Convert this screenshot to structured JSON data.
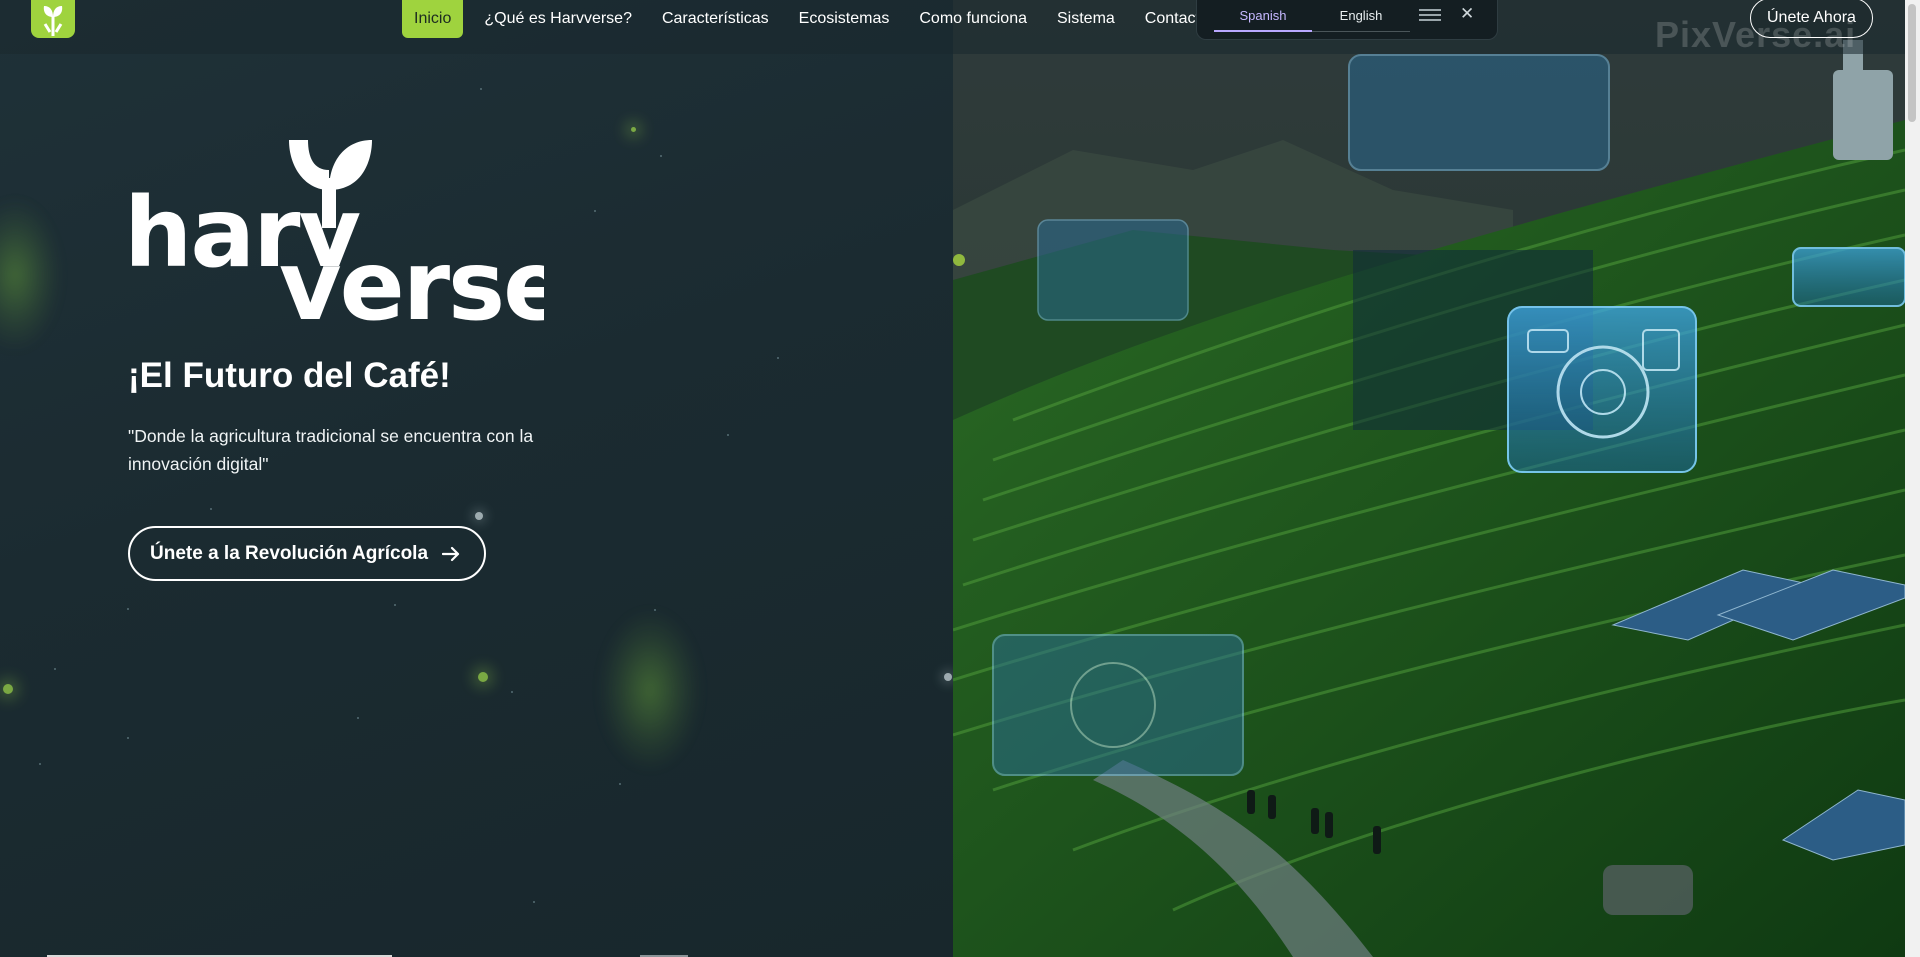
{
  "header": {
    "nav": [
      {
        "label": "Inicio",
        "active": true
      },
      {
        "label": "¿Qué es Harvverse?"
      },
      {
        "label": "Características"
      },
      {
        "label": "Ecosistemas"
      },
      {
        "label": "Como funciona"
      },
      {
        "label": "Sistema"
      },
      {
        "label": "Contacto"
      }
    ],
    "cta_label": "Únete Ahora",
    "brand_icon": "sprout-icon"
  },
  "language_switcher": {
    "options": [
      "Spanish",
      "English"
    ],
    "selected": "Spanish",
    "menu_icon": "hamburger-icon",
    "close_icon": "close-icon"
  },
  "hero": {
    "logo_text": [
      "harv",
      "verse"
    ],
    "title": "¡El Futuro del Café!",
    "quote": "\"Donde la agricultura tradicional se encuentra con la innovación digital\"",
    "cta_label": "Únete a la Revolución Agrícola",
    "cta_icon": "arrow-right-icon"
  },
  "image_watermark": "PixVerse.ai",
  "colors": {
    "accent": "#9fd33e",
    "background": "#1b2a30",
    "lang_selected": "#c6b8ff"
  }
}
